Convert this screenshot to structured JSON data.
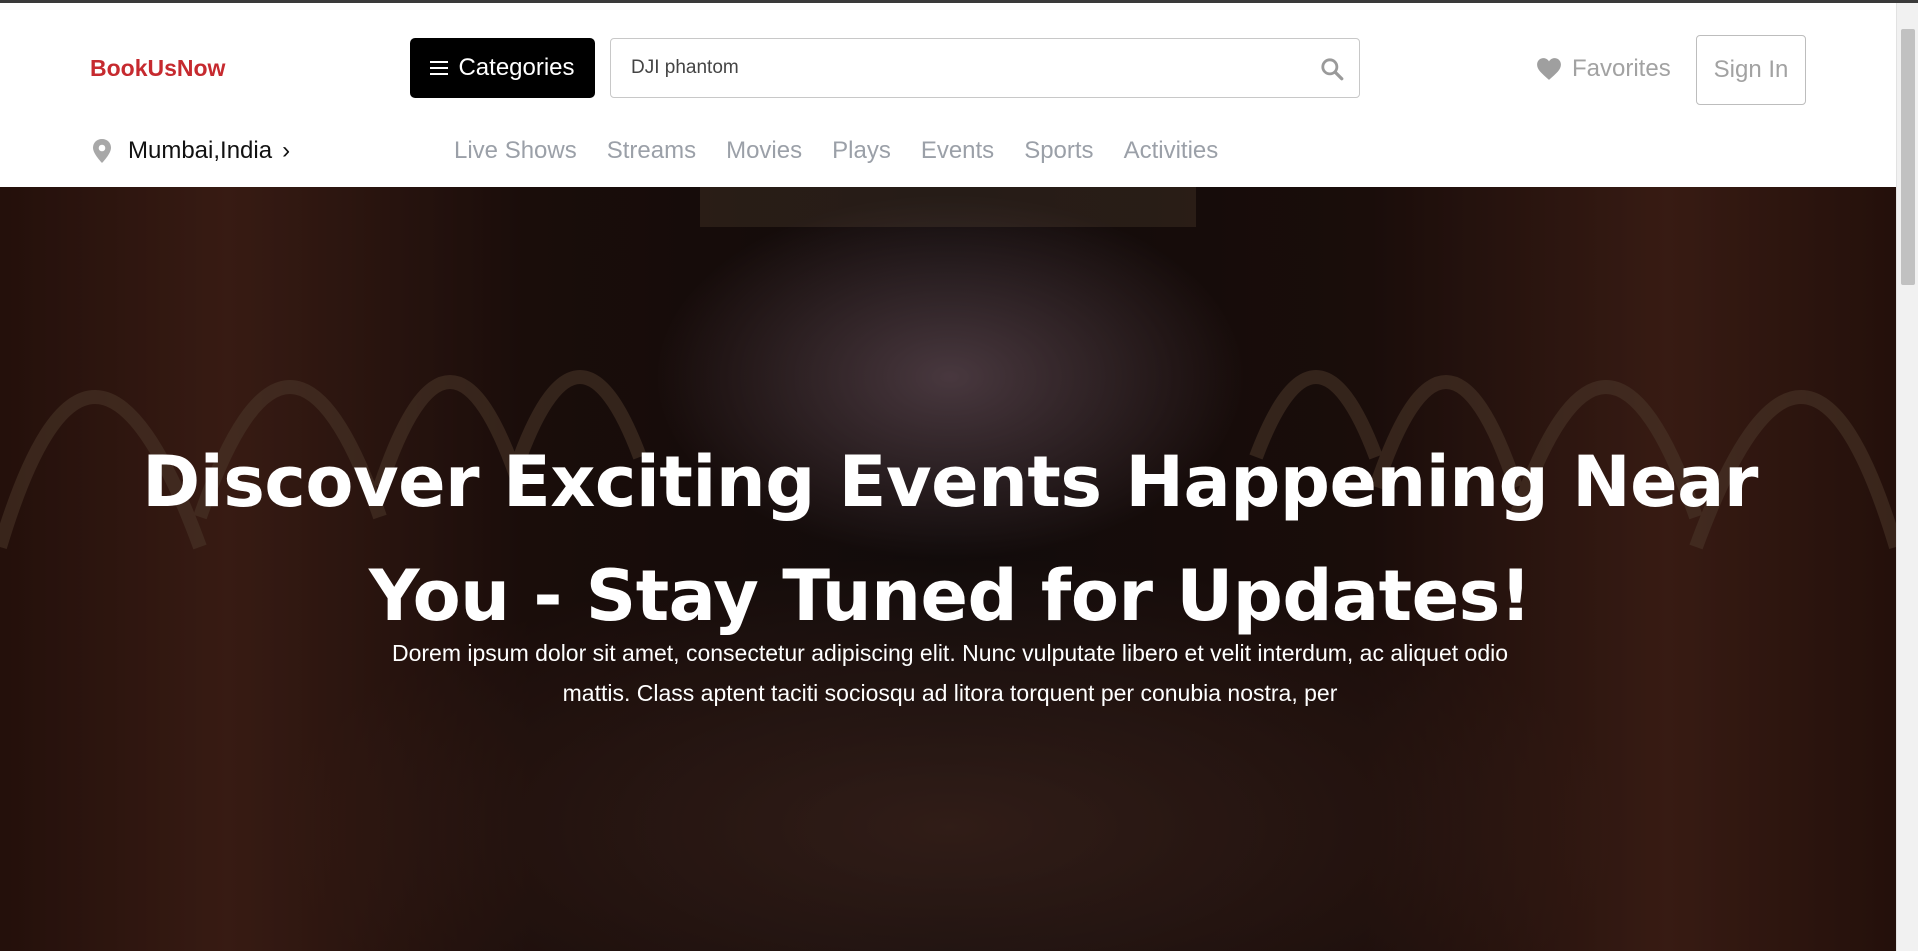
{
  "brand": {
    "name": "BookUsNow",
    "color": "#c62a2f"
  },
  "header": {
    "categories_label": "Categories",
    "search": {
      "value": "DJI phantom",
      "placeholder": "Search"
    },
    "favorites_label": "Favorites",
    "signin_label": "Sign In"
  },
  "location": {
    "label": "Mumbai,India",
    "chevron": "›"
  },
  "nav": {
    "items": [
      {
        "label": "Live Shows"
      },
      {
        "label": "Streams"
      },
      {
        "label": "Movies"
      },
      {
        "label": "Plays"
      },
      {
        "label": "Events"
      },
      {
        "label": "Sports"
      },
      {
        "label": "Activities"
      }
    ]
  },
  "hero": {
    "title_line1": "Discover Exciting Events Happening Near",
    "title_line2": "You - Stay Tuned for Updates!",
    "subtitle": "Dorem ipsum dolor sit amet, consectetur adipiscing elit. Nunc vulputate libero et velit interdum, ac aliquet odio mattis. Class aptent taciti sociosqu ad litora torquent per conubia nostra, per"
  },
  "icons": {
    "menu": "menu-icon",
    "search": "search-icon",
    "favorites": "heart-icon",
    "location": "map-pin-icon"
  }
}
